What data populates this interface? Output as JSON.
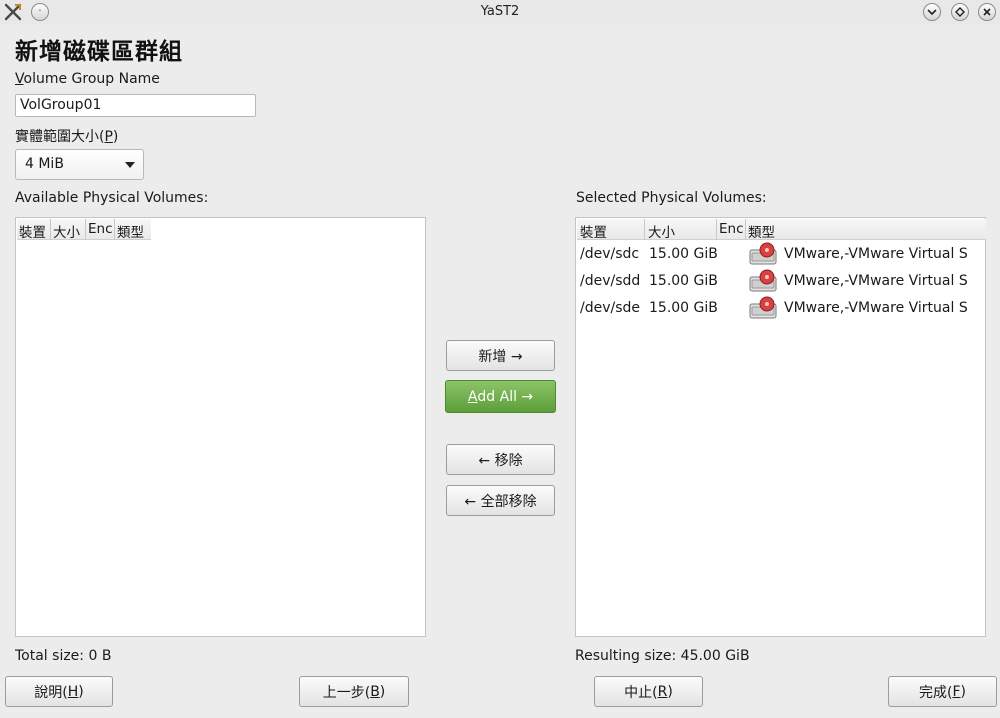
{
  "window": {
    "title": "YaST2"
  },
  "heading": "新增磁碟區群組",
  "vg_name": {
    "label_first": "V",
    "label_rest": "olume Group Name",
    "value": "VolGroup01"
  },
  "extent": {
    "label_prefix": "實體範圍大小(",
    "label_key": "P",
    "label_suffix": ")",
    "value": "4 MiB"
  },
  "available": {
    "label": "Available Physical Volumes:",
    "columns": [
      "裝置",
      "大小",
      "Enc",
      "類型"
    ],
    "total": "Total size: 0 B"
  },
  "selected": {
    "label": "Selected Physical Volumes:",
    "columns": [
      "裝置",
      "大小",
      "Enc",
      "類型"
    ],
    "rows": [
      {
        "device": "/dev/sdc",
        "size": "15.00 GiB",
        "enc": "",
        "type": "VMware,-VMware Virtual S",
        "icon": "hard-disk-icon"
      },
      {
        "device": "/dev/sdd",
        "size": "15.00 GiB",
        "enc": "",
        "type": "VMware,-VMware Virtual S",
        "icon": "hard-disk-icon"
      },
      {
        "device": "/dev/sde",
        "size": "15.00 GiB",
        "enc": "",
        "type": "VMware,-VMware Virtual S",
        "icon": "hard-disk-icon"
      }
    ],
    "total": "Resulting size: 45.00 GiB"
  },
  "transfer": {
    "add": "新增 →",
    "add_all_key": "A",
    "add_all_rest": "dd All →",
    "remove": "← 移除",
    "remove_all": "← 全部移除"
  },
  "footer": {
    "help": {
      "text": "說明(",
      "key": "H",
      "end": ")"
    },
    "back": {
      "text": "上一步(",
      "key": "B",
      "end": ")"
    },
    "abort": {
      "text": "中止(",
      "key": "R",
      "end": ")"
    },
    "finish": {
      "text": "完成(",
      "key": "F",
      "end": ")"
    }
  },
  "colors": {
    "accent_green": "#6aab45",
    "background": "#ececec"
  }
}
